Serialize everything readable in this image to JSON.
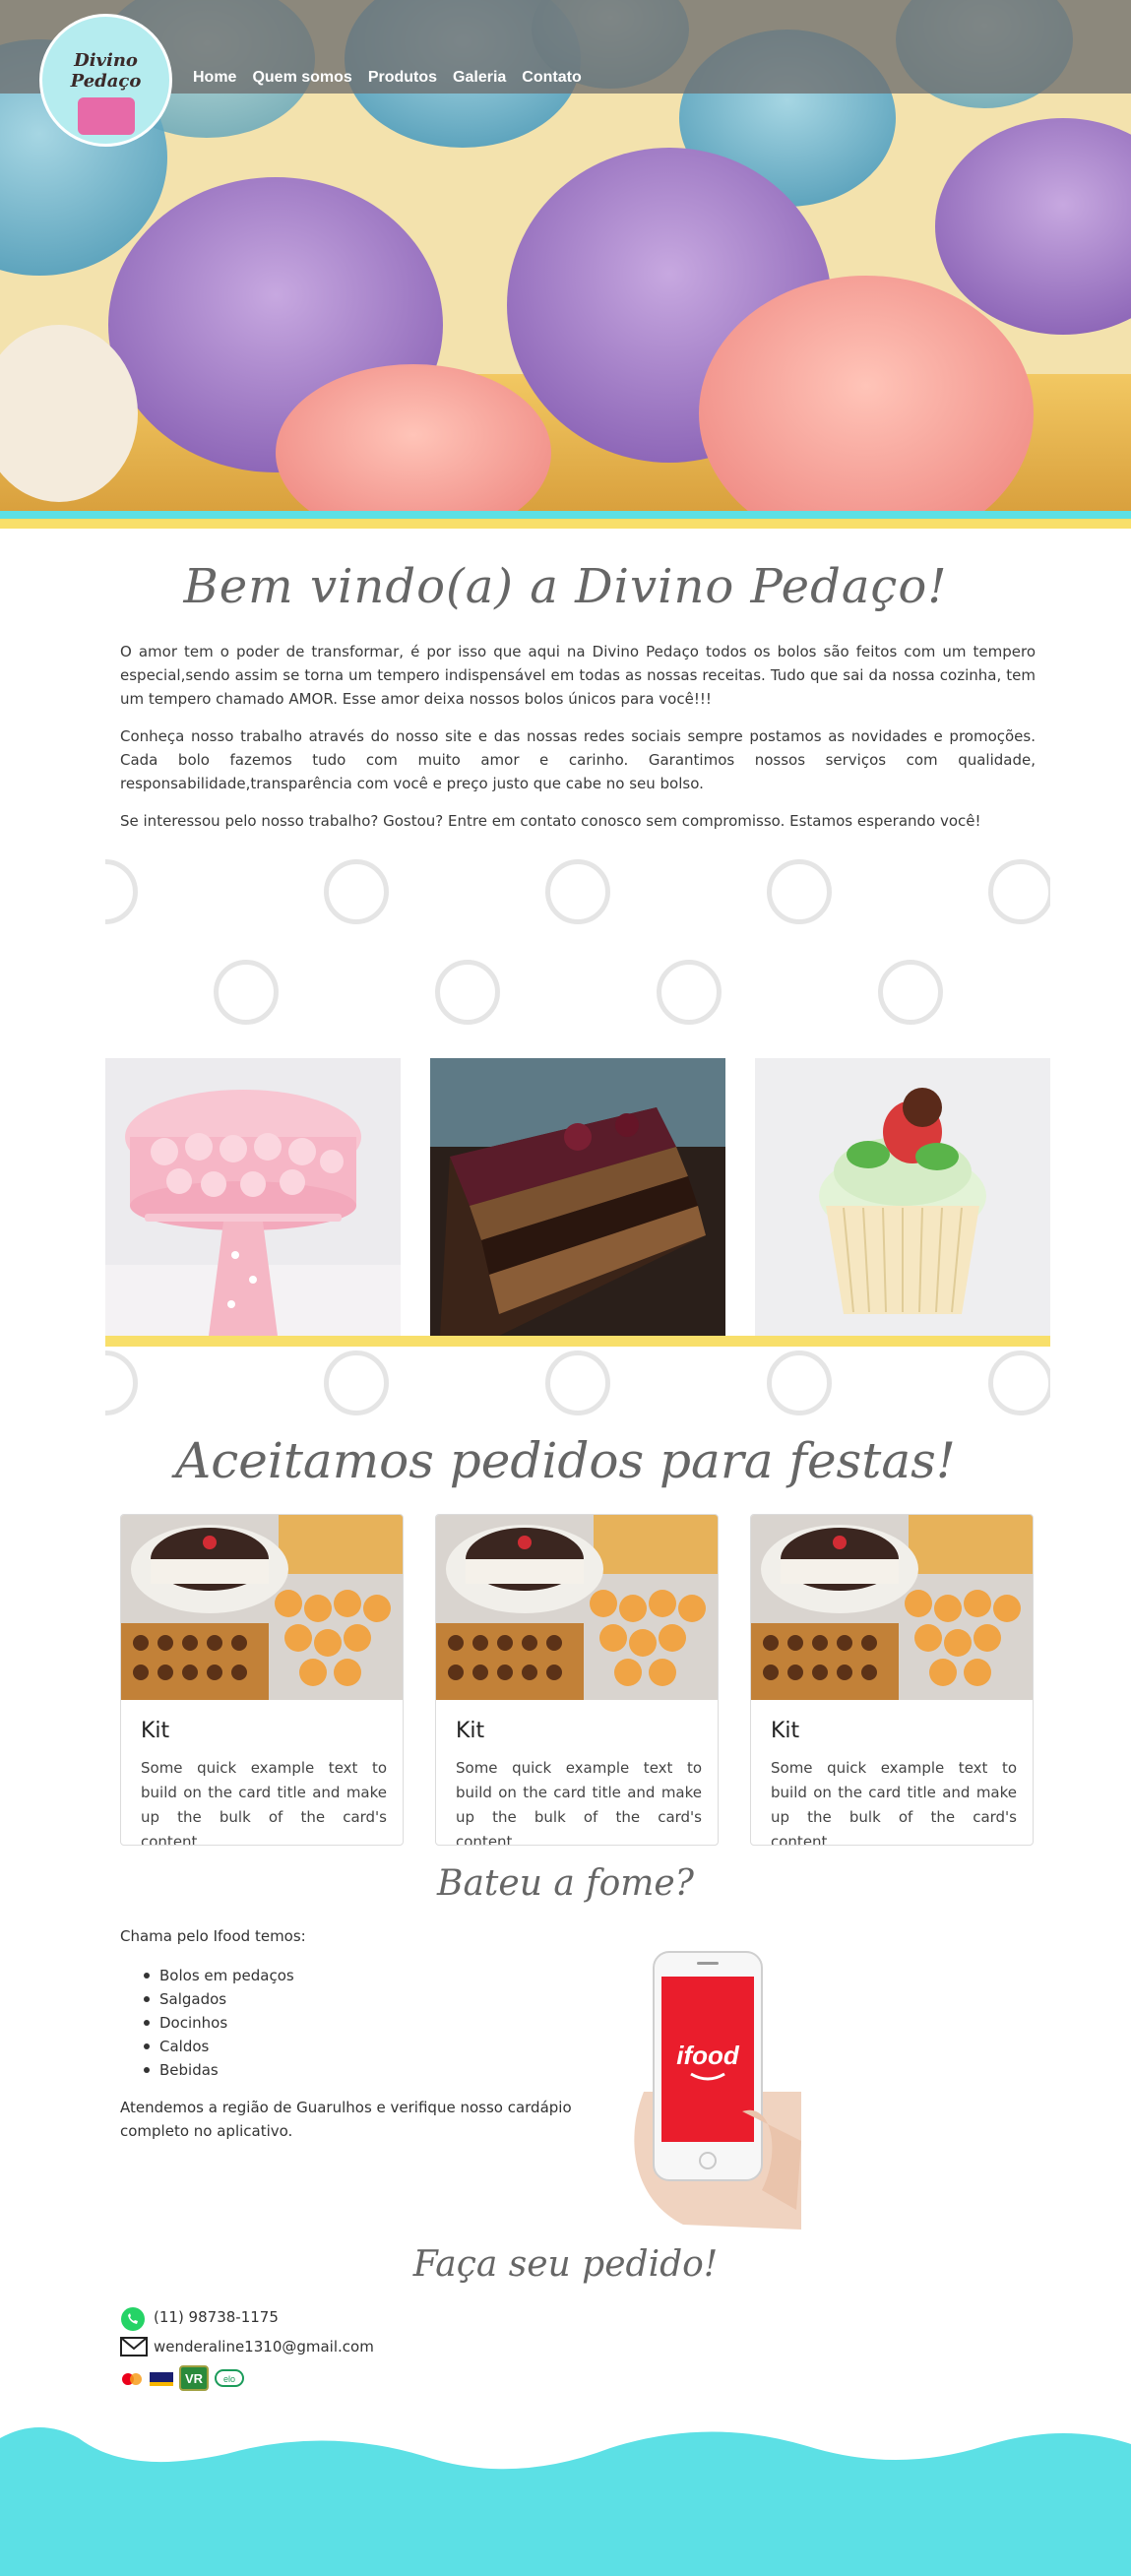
{
  "brand": {
    "name": "Divino Pedaço",
    "colors": {
      "turquoise": "#5ce0e5",
      "yellow": "#f8df6a",
      "ifood_red": "#ea1d2c"
    }
  },
  "nav": {
    "items": [
      "Home",
      "Quem somos",
      "Produtos",
      "Galeria",
      "Contato"
    ]
  },
  "welcome": {
    "title": "Bem vindo(a) a Divino Pedaço!",
    "paragraphs": [
      "O amor tem o poder de transformar, é por isso que aqui na Divino Pedaço todos os bolos são feitos com um tempero especial,sendo assim se torna um tempero indispensável em todas as nossas receitas. Tudo que sai da nossa cozinha, tem um tempero chamado AMOR. Esse amor deixa nossos bolos únicos para você!!!",
      "Conheça nosso trabalho através do nosso site e das nossas redes sociais sempre postamos as novidades e promoções. Cada bolo fazemos tudo com muito amor e carinho. Garantimos nossos serviços com qualidade, responsabilidade,transparência com você e preço justo que cabe no seu bolso.",
      "Se interessou pelo nosso trabalho? Gostou? Entre em contato conosco sem compromisso. Estamos esperando você!"
    ]
  },
  "gallery": {
    "photos": [
      "pink-rose-cake",
      "chocolate-cake-slice",
      "strawberry-cupcake"
    ]
  },
  "party": {
    "title": "Aceitamos pedidos para festas!",
    "cards": [
      {
        "title": "Kit",
        "text": "Some quick example text to build on the card title and make up the bulk of the card's content."
      },
      {
        "title": "Kit",
        "text": "Some quick example text to build on the card title and make up the bulk of the card's content."
      },
      {
        "title": "Kit",
        "text": "Some quick example text to build on the card title and make up the bulk of the card's content."
      }
    ]
  },
  "hungry": {
    "title": "Bateu a fome?",
    "intro": "Chama pelo Ifood temos:",
    "items": [
      "Bolos em pedaços",
      "Salgados",
      "Docinhos",
      "Caldos",
      "Bebidas"
    ],
    "note": "Atendemos a região de Guarulhos e verifique nosso cardápio completo no aplicativo.",
    "app_logo": "ifood"
  },
  "order": {
    "title": "Faça seu pedido!",
    "phone": "(11) 98738-1175",
    "email": "wenderaline1310@gmail.com",
    "payments": [
      "mastercard-icon",
      "visa-icon",
      "vr-icon",
      "elo-icon"
    ],
    "payment_labels": {
      "vr": "VR",
      "elo": "elo"
    }
  }
}
